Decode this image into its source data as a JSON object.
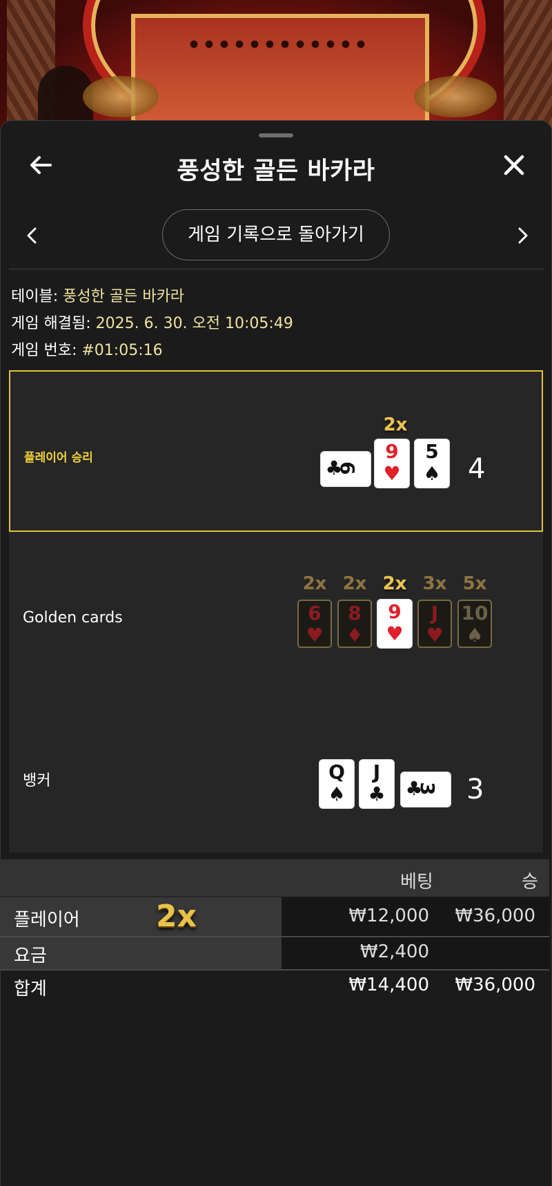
{
  "header": {
    "title": "풍성한 골든 바카라",
    "back_button": "게임 기록으로 돌아가기"
  },
  "info": {
    "table_label": "테이블:",
    "table_value": "풍성한 골든 바카라",
    "resolved_label": "게임 해결됨:",
    "resolved_value": "2025. 6. 30. 오전 10:05:49",
    "game_no_label": "게임 번호:",
    "game_no_value": "#01:05:16"
  },
  "player": {
    "label": "플레이어 승리",
    "score": "4",
    "multiplier": "2x",
    "cards": [
      {
        "rank": "6",
        "suit": "♣",
        "color": "black",
        "orientation": "side"
      },
      {
        "rank": "9",
        "suit": "♥",
        "color": "red",
        "orientation": "up"
      },
      {
        "rank": "5",
        "suit": "♠",
        "color": "black",
        "orientation": "up"
      }
    ]
  },
  "golden": {
    "label": "Golden cards",
    "cards": [
      {
        "rank": "6",
        "suit": "♥",
        "color": "red",
        "mult": "2x",
        "active": false
      },
      {
        "rank": "8",
        "suit": "♦",
        "color": "red",
        "mult": "2x",
        "active": false
      },
      {
        "rank": "9",
        "suit": "♥",
        "color": "red",
        "mult": "2x",
        "active": true
      },
      {
        "rank": "J",
        "suit": "♥",
        "color": "red",
        "mult": "3x",
        "active": false
      },
      {
        "rank": "10",
        "suit": "♠",
        "color": "black",
        "mult": "5x",
        "active": false
      }
    ]
  },
  "banker": {
    "label": "뱅커",
    "score": "3",
    "cards": [
      {
        "rank": "Q",
        "suit": "♠",
        "color": "black",
        "orientation": "up"
      },
      {
        "rank": "J",
        "suit": "♣",
        "color": "black",
        "orientation": "up"
      },
      {
        "rank": "3",
        "suit": "♣",
        "color": "black",
        "orientation": "side"
      }
    ]
  },
  "bets": {
    "col_bet": "베팅",
    "col_win": "승",
    "rows": [
      {
        "label": "플레이어",
        "badge": "2x",
        "bet": "₩12,000",
        "win": "₩36,000"
      },
      {
        "label": "요금",
        "badge": "",
        "bet": "₩2,400",
        "win": ""
      }
    ],
    "total": {
      "label": "합계",
      "bet": "₩14,400",
      "win": "₩36,000"
    }
  },
  "colors": {
    "accent_gold": "#e2c337",
    "panel": "#262626",
    "background": "#1b1b1b"
  },
  "icons": [
    "arrow-left-icon",
    "close-icon",
    "chevron-left-icon",
    "chevron-right-icon",
    "drag-handle-icon"
  ]
}
